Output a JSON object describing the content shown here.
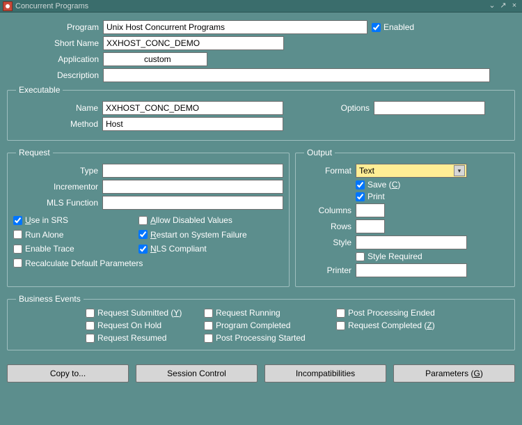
{
  "window": {
    "title": "Concurrent Programs"
  },
  "header": {
    "program_label": "Program",
    "program": "Unix Host Concurrent Programs",
    "enabled_label": "Enabled",
    "enabled": true,
    "short_name_label": "Short Name",
    "short_name": "XXHOST_CONC_DEMO",
    "application_label": "Application",
    "application": "        custom      ",
    "description_label": "Description",
    "description": ""
  },
  "executable": {
    "legend": "Executable",
    "name_label": "Name",
    "name": "XXHOST_CONC_DEMO",
    "options_label": "Options",
    "options": "",
    "method_label": "Method",
    "method": "Host"
  },
  "request": {
    "legend": "Request",
    "type_label": "Type",
    "type": "",
    "incrementor_label": "Incrementor",
    "incrementor": "",
    "mls_label": "MLS Function",
    "mls": "",
    "use_in_srs": {
      "label": "Use in SRS",
      "checked": true
    },
    "allow_disabled": {
      "label": "Allow Disabled Values",
      "checked": false
    },
    "run_alone": {
      "label": "Run Alone",
      "checked": false
    },
    "restart": {
      "label": "Restart on System Failure",
      "checked": true
    },
    "enable_trace": {
      "label": "Enable Trace",
      "checked": false
    },
    "nls_compliant": {
      "label": "NLS Compliant",
      "checked": true
    },
    "recalc": {
      "label": "Recalculate Default Parameters",
      "checked": false
    }
  },
  "output": {
    "legend": "Output",
    "format_label": "Format",
    "format": "Text",
    "save_pre": "Save (",
    "save_u": "C",
    "save_post": ")",
    "save_checked": true,
    "print_label": "Print",
    "print_checked": true,
    "columns_label": "Columns",
    "columns": "",
    "rows_label": "Rows",
    "rows": "",
    "style_label": "Style",
    "style": "",
    "style_required_label": "Style Required",
    "style_required": false,
    "printer_label": "Printer",
    "printer": ""
  },
  "biz": {
    "legend": "Business Events",
    "req_sub_pre": "Request Submitted (",
    "req_sub_u": "Y",
    "req_sub_post": ")",
    "req_running": "Request Running",
    "post_proc_ended": "Post Processing Ended",
    "req_on_hold": "Request On Hold",
    "prog_completed": "Program Completed",
    "req_compl_pre": "Request Completed (",
    "req_compl_u": "Z",
    "req_compl_post": ")",
    "req_resumed": "Request Resumed",
    "post_proc_started": "Post Processing Started"
  },
  "buttons": {
    "copy_to": "Copy to...",
    "session_control": "Session Control",
    "incompatibilities": "Incompatibilities",
    "parameters_pre": "Parameters (",
    "parameters_u": "G",
    "parameters_post": ")"
  }
}
